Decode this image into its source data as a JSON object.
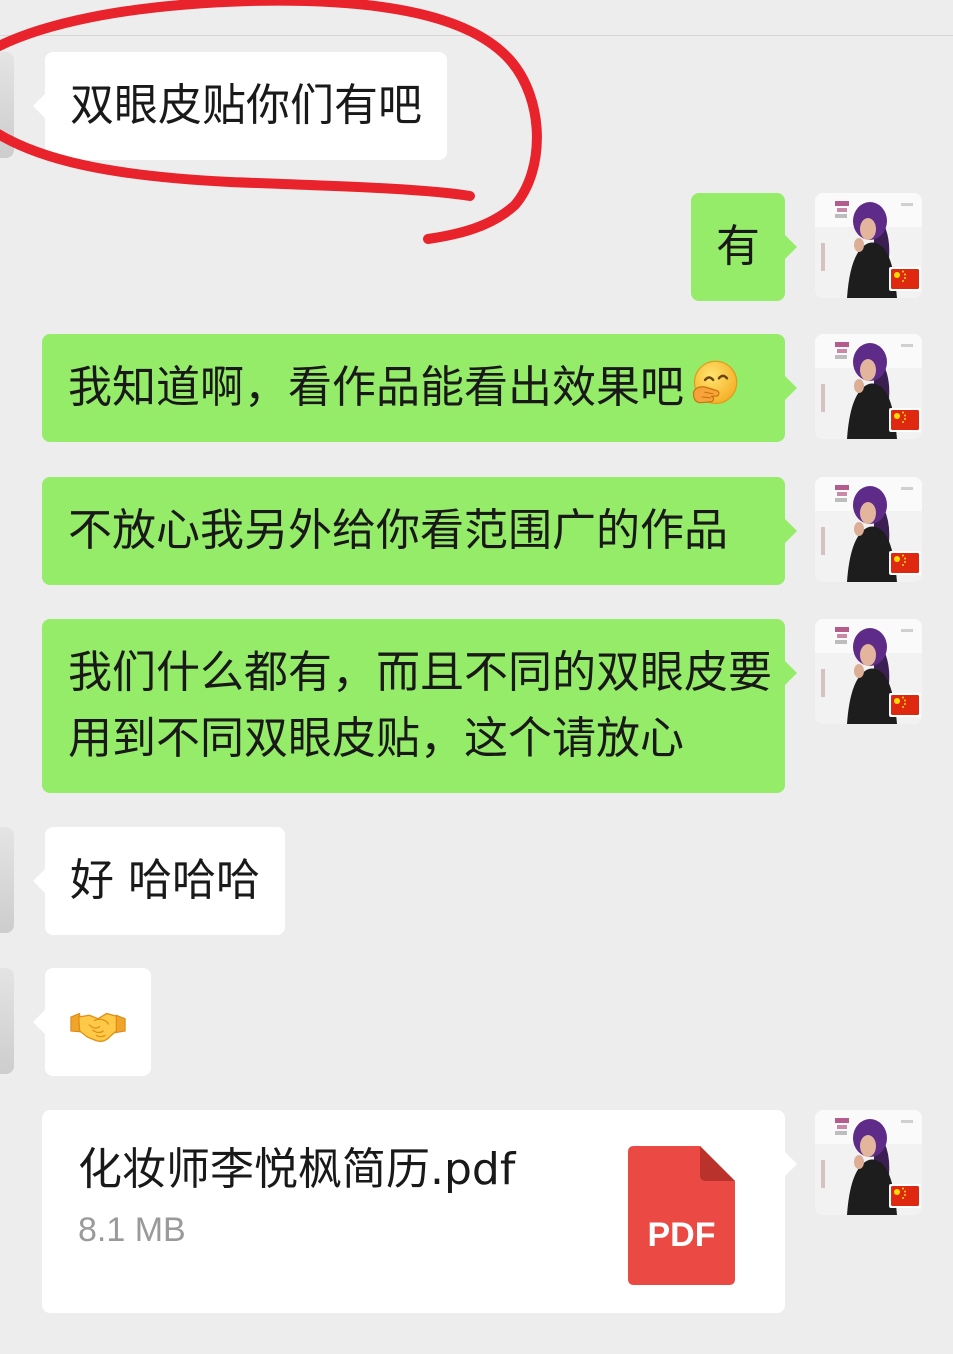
{
  "messages": [
    {
      "received_text": "双眼皮贴你们有吧"
    },
    {
      "sent_text": "有"
    },
    {
      "sent_text": "我知道啊，看作品能看出效果吧",
      "emoji_icon": "face-with-hand-over-mouth"
    },
    {
      "sent_text": "不放心我另外给你看范围广的作品"
    },
    {
      "sent_lines": [
        "我们什么都有，而且不同的双眼皮要",
        "用到不同双眼皮贴，这个请放心"
      ]
    },
    {
      "received_text": "好 哈哈哈"
    },
    {
      "received_emoji_icon": "handshake"
    },
    {
      "sent_file": {
        "name": "化妆师李悦枫简历.pdf",
        "size": "8.1 MB",
        "badge": "PDF"
      }
    }
  ],
  "colors": {
    "background": "#ededed",
    "sent_bubble": "#95ec69",
    "received_bubble": "#ffffff",
    "annotation_stroke": "#e8232b",
    "pdf_badge": "#ea4a43",
    "file_size_text": "#9a9a9a"
  }
}
